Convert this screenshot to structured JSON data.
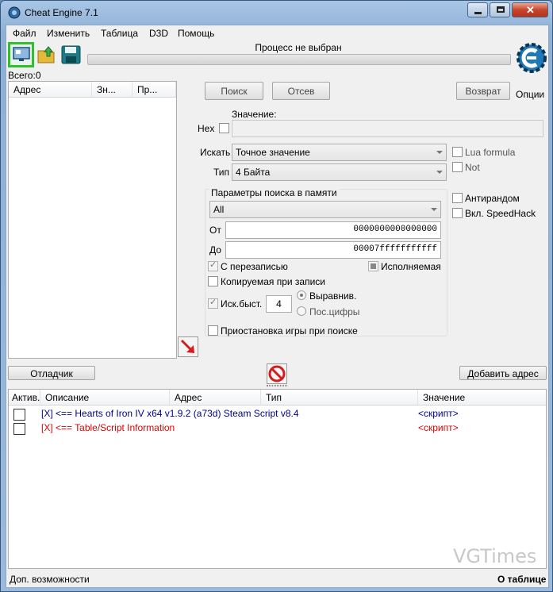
{
  "window": {
    "title": "Cheat Engine 7.1"
  },
  "menu": [
    "Файл",
    "Изменить",
    "Таблица",
    "D3D",
    "Помощь"
  ],
  "process": {
    "label": "Процесс не выбран"
  },
  "found": {
    "label": "Всего:",
    "count": "0"
  },
  "results_list": {
    "columns": [
      "Адрес",
      "Зн...",
      "Пр..."
    ]
  },
  "scan": {
    "first_scan": "Поиск",
    "next_scan": "Отсев",
    "undo_scan": "Возврат",
    "settings_label": "Опции",
    "value_label": "Значение:",
    "hex_label": "Hex",
    "scan_type_label": "Искать",
    "scan_type_value": "Точное значение",
    "value_type_label": "Тип",
    "value_type_value": "4 Байта",
    "lua_formula": "Lua formula",
    "not_label": "Not",
    "unrandomizer": "Антирандом",
    "speedhack": "Вкл. SpeedHack"
  },
  "memory_options": {
    "title": "Параметры поиска в памяти",
    "region": "All",
    "from_label": "От",
    "from_value": "0000000000000000",
    "to_label": "До",
    "to_value": "00007fffffffffff",
    "writable": "С перезаписью",
    "executable": "Исполняемая",
    "copy_on_write": "Копируемая при записи",
    "fast_scan": "Иск.быст.",
    "fast_scan_value": "4",
    "alignment": "Выравнив.",
    "last_digits": "Пос.цифры",
    "pause_game": "Приостановка игры при поиске"
  },
  "buttons": {
    "memory_view": "Отладчик",
    "add_address": "Добавить адрес"
  },
  "cheat_table": {
    "columns": [
      "Актив.",
      "Описание",
      "Адрес",
      "Тип",
      "Значение"
    ],
    "rows": [
      {
        "description": "[X] <== Hearts of Iron IV x64 v1.9.2 (a73d) Steam Script v8.4",
        "value": "<скрипт>",
        "color": "#00008b"
      },
      {
        "description": "[X] <== Table/Script Information",
        "value": "<скрипт>",
        "color": "#e00000"
      }
    ]
  },
  "watermark": "VGTimes",
  "status": {
    "left": "Доп. возможности",
    "right": "О таблице"
  }
}
